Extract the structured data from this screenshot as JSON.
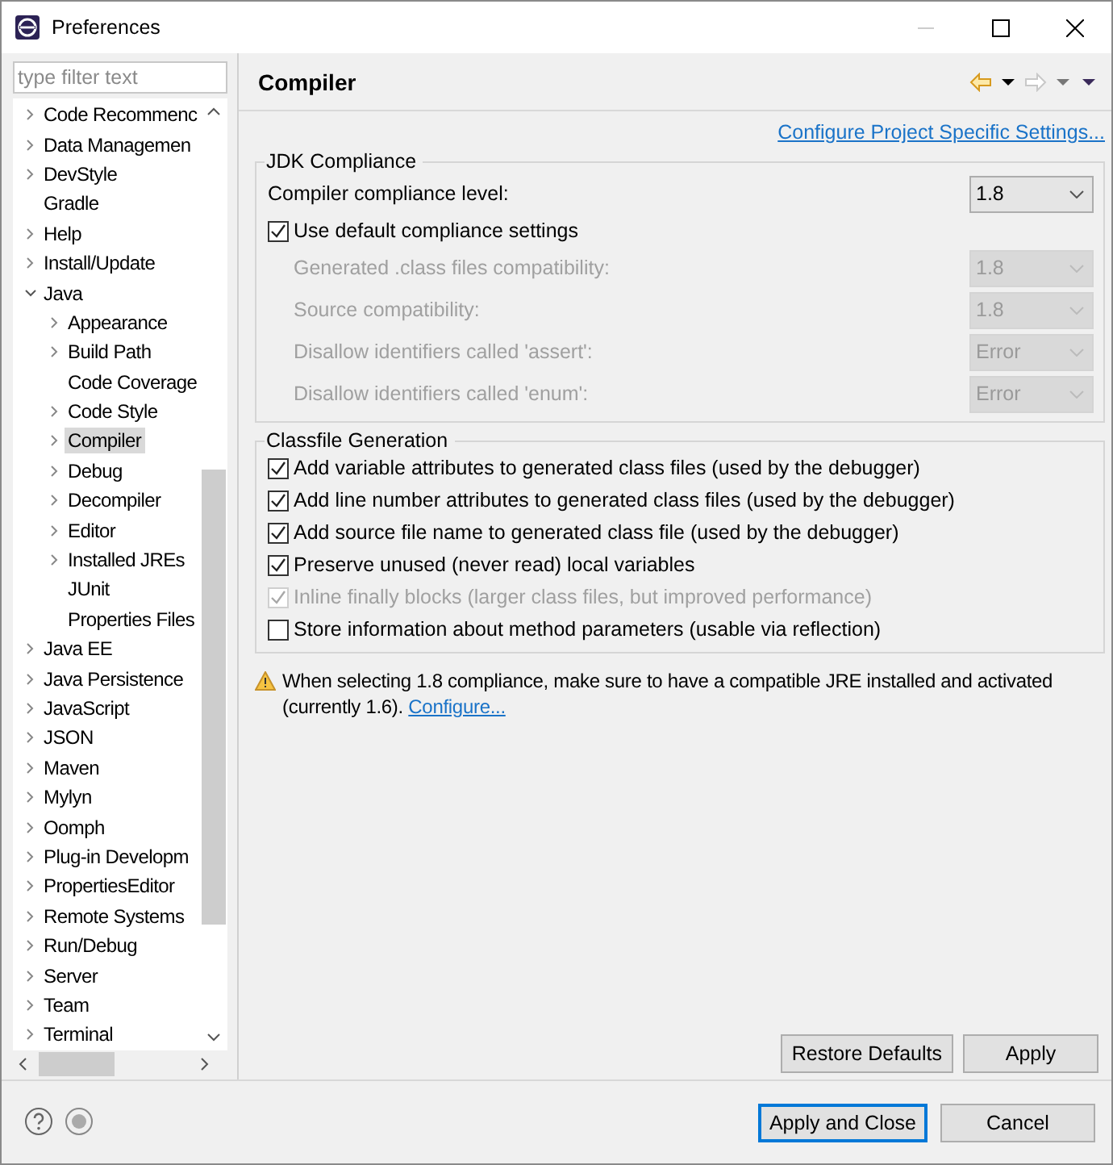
{
  "window": {
    "title": "Preferences"
  },
  "filter": {
    "placeholder": "type filter text"
  },
  "tree": [
    {
      "label": "Code Recommenc",
      "kind": "folder",
      "expanded": false,
      "selected": false
    },
    {
      "label": "Data Managemen",
      "kind": "folder",
      "expanded": false,
      "selected": false
    },
    {
      "label": "DevStyle",
      "kind": "folder",
      "expanded": false,
      "selected": false
    },
    {
      "label": "Gradle",
      "kind": "leaf",
      "expanded": false,
      "selected": false
    },
    {
      "label": "Help",
      "kind": "folder",
      "expanded": false,
      "selected": false
    },
    {
      "label": "Install/Update",
      "kind": "folder",
      "expanded": false,
      "selected": false
    },
    {
      "label": "Java",
      "kind": "folder",
      "expanded": true,
      "selected": false,
      "children": [
        {
          "label": "Appearance",
          "kind": "folder",
          "expanded": false,
          "selected": false
        },
        {
          "label": "Build Path",
          "kind": "folder",
          "expanded": false,
          "selected": false
        },
        {
          "label": "Code Coverage",
          "kind": "leaf",
          "expanded": false,
          "selected": false
        },
        {
          "label": "Code Style",
          "kind": "folder",
          "expanded": false,
          "selected": false
        },
        {
          "label": "Compiler",
          "kind": "folder",
          "expanded": false,
          "selected": true
        },
        {
          "label": "Debug",
          "kind": "folder",
          "expanded": false,
          "selected": false
        },
        {
          "label": "Decompiler",
          "kind": "folder",
          "expanded": false,
          "selected": false
        },
        {
          "label": "Editor",
          "kind": "folder",
          "expanded": false,
          "selected": false
        },
        {
          "label": "Installed JREs",
          "kind": "folder",
          "expanded": false,
          "selected": false
        },
        {
          "label": "JUnit",
          "kind": "leaf",
          "expanded": false,
          "selected": false
        },
        {
          "label": "Properties Files",
          "kind": "leaf",
          "expanded": false,
          "selected": false
        }
      ]
    },
    {
      "label": "Java EE",
      "kind": "folder",
      "expanded": false,
      "selected": false
    },
    {
      "label": "Java Persistence",
      "kind": "folder",
      "expanded": false,
      "selected": false
    },
    {
      "label": "JavaScript",
      "kind": "folder",
      "expanded": false,
      "selected": false
    },
    {
      "label": "JSON",
      "kind": "folder",
      "expanded": false,
      "selected": false
    },
    {
      "label": "Maven",
      "kind": "folder",
      "expanded": false,
      "selected": false
    },
    {
      "label": "Mylyn",
      "kind": "folder",
      "expanded": false,
      "selected": false
    },
    {
      "label": "Oomph",
      "kind": "folder",
      "expanded": false,
      "selected": false
    },
    {
      "label": "Plug-in Developm",
      "kind": "folder",
      "expanded": false,
      "selected": false
    },
    {
      "label": "PropertiesEditor",
      "kind": "folder",
      "expanded": false,
      "selected": false
    },
    {
      "label": "Remote Systems",
      "kind": "folder",
      "expanded": false,
      "selected": false
    },
    {
      "label": "Run/Debug",
      "kind": "folder",
      "expanded": false,
      "selected": false
    },
    {
      "label": "Server",
      "kind": "folder",
      "expanded": false,
      "selected": false
    },
    {
      "label": "Team",
      "kind": "folder",
      "expanded": false,
      "selected": false
    },
    {
      "label": "Terminal",
      "kind": "folder",
      "expanded": false,
      "selected": false
    }
  ],
  "page": {
    "title": "Compiler",
    "link": "Configure Project Specific Settings..."
  },
  "jdk": {
    "title": "JDK Compliance",
    "level_label": "Compiler compliance level:",
    "level_value": "1.8",
    "use_default": {
      "label": "Use default compliance settings",
      "checked": true
    },
    "settings": [
      {
        "label": "Generated .class files compatibility:",
        "value": "1.8",
        "disabled": true
      },
      {
        "label": "Source compatibility:",
        "value": "1.8",
        "disabled": true
      },
      {
        "label": "Disallow identifiers called 'assert':",
        "value": "Error",
        "disabled": true
      },
      {
        "label": "Disallow identifiers called 'enum':",
        "value": "Error",
        "disabled": true
      }
    ]
  },
  "classfile": {
    "title": "Classfile Generation",
    "options": [
      {
        "label": "Add variable attributes to generated class files (used by the debugger)",
        "checked": true,
        "disabled": false
      },
      {
        "label": "Add line number attributes to generated class files (used by the debugger)",
        "checked": true,
        "disabled": false
      },
      {
        "label": "Add source file name to generated class file (used by the debugger)",
        "checked": true,
        "disabled": false
      },
      {
        "label": "Preserve unused (never read) local variables",
        "checked": true,
        "disabled": false
      },
      {
        "label": "Inline finally blocks (larger class files, but improved performance)",
        "checked": true,
        "disabled": true
      },
      {
        "label": "Store information about method parameters (usable via reflection)",
        "checked": false,
        "disabled": false
      }
    ]
  },
  "warning": {
    "text": "When selecting 1.8 compliance, make sure to have a compatible JRE installed and activated (currently 1.6).",
    "link": "Configure..."
  },
  "page_buttons": [
    {
      "label": "Restore Defaults"
    },
    {
      "label": "Apply"
    }
  ],
  "dialog_buttons": [
    {
      "label": "Apply and Close",
      "default": true
    },
    {
      "label": "Cancel",
      "default": false
    }
  ]
}
